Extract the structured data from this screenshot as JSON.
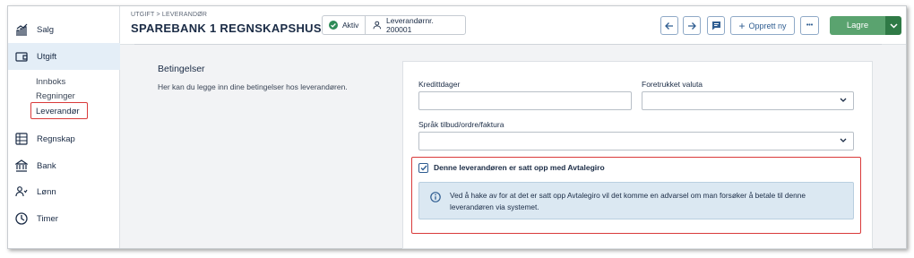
{
  "sidebar": {
    "items": [
      {
        "label": "Salg",
        "icon": "chart-icon"
      },
      {
        "label": "Utgift",
        "icon": "wallet-icon"
      },
      {
        "label": "Regnskap",
        "icon": "ledger-icon"
      },
      {
        "label": "Bank",
        "icon": "bank-icon"
      },
      {
        "label": "Lønn",
        "icon": "people-icon"
      },
      {
        "label": "Timer",
        "icon": "clock-icon"
      }
    ],
    "sub_items": [
      "Innboks",
      "Regninger",
      "Leverandør"
    ]
  },
  "header": {
    "breadcrumb": "UTGIFT > LEVERANDØR",
    "title": "SPAREBANK 1 REGNSKAPSHUS...",
    "status": "Aktiv",
    "supplier_number": "Leverandørnr. 200001",
    "create_new": "Opprett ny",
    "more": "•••",
    "save": "Lagre"
  },
  "section": {
    "title": "Betingelser",
    "description": "Her kan du legge inn dine betingelser hos leverandøren."
  },
  "form": {
    "credit_days_label": "Kredittdager",
    "credit_days_value": "",
    "currency_label": "Foretrukket valuta",
    "currency_value": "",
    "language_label": "Språk tilbud/ordre/faktura",
    "language_value": "",
    "avtalegiro_label": "Denne leverandøren er satt opp med Avtalegiro",
    "avtalegiro_checked": true,
    "info_text": "Ved å hake av for at det er satt opp Avtalegiro vil det komme en advarsel om man forsøker å betale til denne leverandøren via systemet."
  },
  "colors": {
    "accent": "#2f5d91",
    "save_green": "#5aa36f",
    "highlight_red": "#d93a3a",
    "info_bg": "#dbe8f2"
  }
}
